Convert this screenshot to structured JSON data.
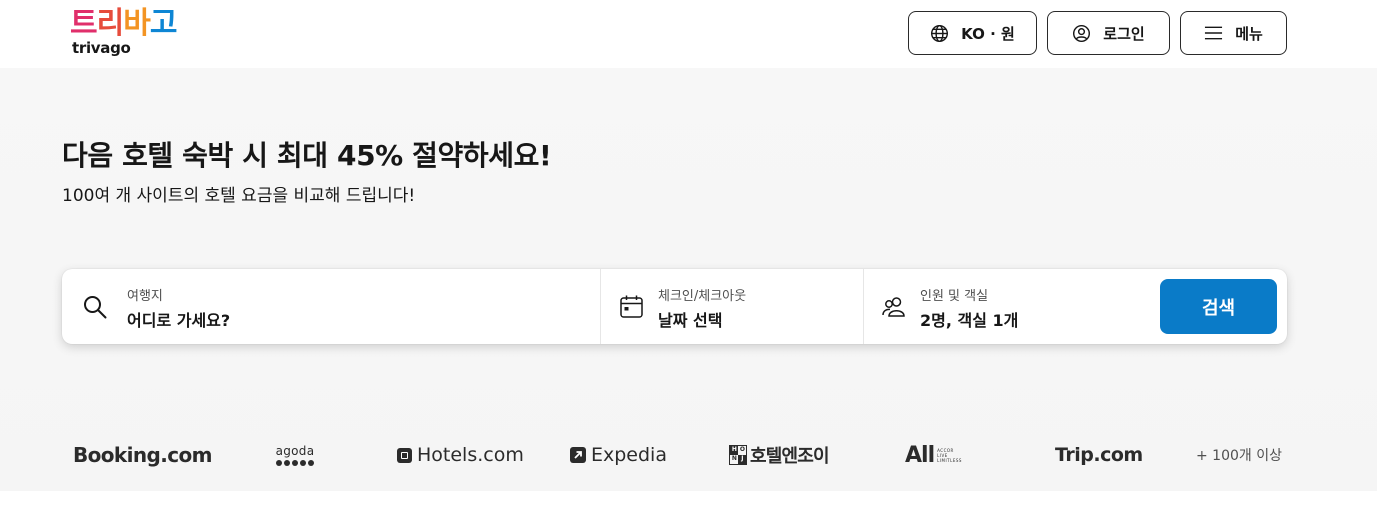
{
  "header": {
    "logo_korean_chars": [
      "트",
      "리",
      "바",
      "고"
    ],
    "logo_english": "trivago",
    "lang_label": "KO · 원",
    "login_label": "로그인",
    "menu_label": "메뉴"
  },
  "hero": {
    "headline": "다음 호텔 숙박 시 최대 45% 절약하세요!",
    "subline": "100여 개 사이트의 호텔 요금을 비교해 드립니다!"
  },
  "search": {
    "destination": {
      "label": "여행지",
      "value": "어디로 가세요?"
    },
    "dates": {
      "label": "체크인/체크아웃",
      "value": "날짜 선택"
    },
    "guests": {
      "label": "인원 및 객실",
      "value": "2명, 객실 1개"
    },
    "button_label": "검색"
  },
  "partners": {
    "booking": "Booking.com",
    "agoda": "agoda",
    "hotels": "Hotels.com",
    "expedia": "Expedia",
    "hotelnjoy": "호텔엔조이",
    "hotelnjoy_box": [
      "H",
      "O",
      "N",
      "J"
    ],
    "all_mark": "All",
    "all_sub": [
      "ACCOR",
      "LIVE",
      "LIMITLESS"
    ],
    "trip": "Trip.com",
    "more": "+ 100개 이상"
  },
  "colors": {
    "logo_red": "#e02f6b",
    "logo_orange": "#f39423",
    "logo_blue": "#0e86d4",
    "search_button": "#0a7bc8",
    "hero_background": "#f7f7f7"
  },
  "icons": {
    "language": "globe-icon",
    "login": "user-circle-icon",
    "menu": "hamburger-icon",
    "destination": "search-icon",
    "dates": "calendar-icon",
    "guests": "users-icon"
  }
}
